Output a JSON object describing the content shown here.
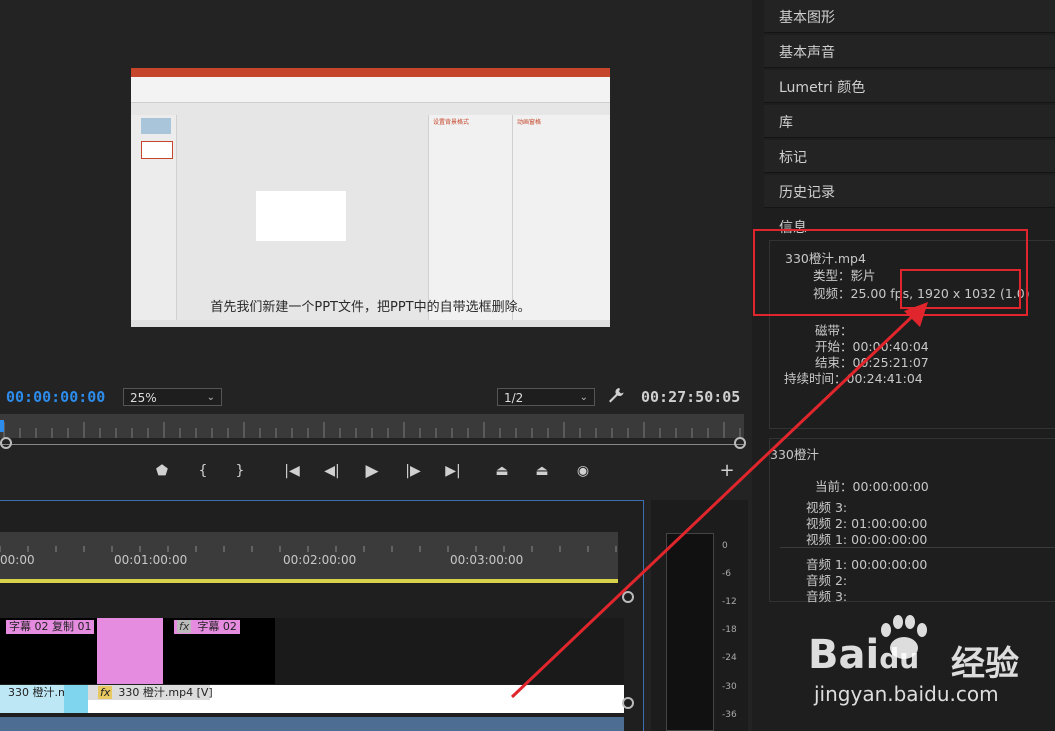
{
  "monitor": {
    "subtitle": "首先我们新建一个PPT文件，把PPT中的自带选框删除。",
    "pane_title": "设置背景格式",
    "pane2_title": "动画窗格",
    "current_timecode": "00:00:00:00",
    "zoom": "25%",
    "resolution": "1/2",
    "duration_timecode": "00:27:50:05"
  },
  "timeline": {
    "ruler_labels": [
      "00:00",
      "00:01:00:00",
      "00:02:00:00",
      "00:03:00:00"
    ],
    "clip_title_a": "字幕 02 复制 01",
    "clip_title_b": "字幕 02",
    "fx": "fx",
    "clip_v1_a": "330 橙汁.m",
    "clip_v1_c": "330 橙汁.mp4 [V]"
  },
  "meter": {
    "db_labels": [
      "0",
      "-6",
      "-12",
      "-18",
      "-24",
      "-30",
      "-36"
    ]
  },
  "right_panel": {
    "items": [
      "基本图形",
      "基本声音",
      "Lumetri 颜色",
      "库",
      "标记",
      "历史记录",
      "信息"
    ],
    "info": {
      "filename": "330橙汁.mp4",
      "type": "类型：影片",
      "video": "视频：25.00 fps, 1920 x 1032 (1.0)",
      "tape": "磁带：",
      "start": "开始：00:00:40:04",
      "end": "结束：00:25:21:07",
      "duration": "持续时间：00:24:41:04"
    },
    "sequence": {
      "name": "330橙汁",
      "current": "当前：00:00:00:00",
      "v3": "视频 3:",
      "v2": "视频 2: 01:00:00:00",
      "v1": "视频 1: 00:00:00:00",
      "a1": "音频 1: 00:00:00:00",
      "a2": "音频 2:",
      "a3": "音频 3:"
    }
  },
  "watermark": {
    "brand": "Bai",
    "brand2": "du",
    "brand_cn": "经验",
    "url": "jingyan.baidu.com"
  },
  "colors": {
    "accent_blue": "#2d8ceb",
    "annotation_red": "#e0262c",
    "title_clip_pink": "#e58ce0"
  }
}
